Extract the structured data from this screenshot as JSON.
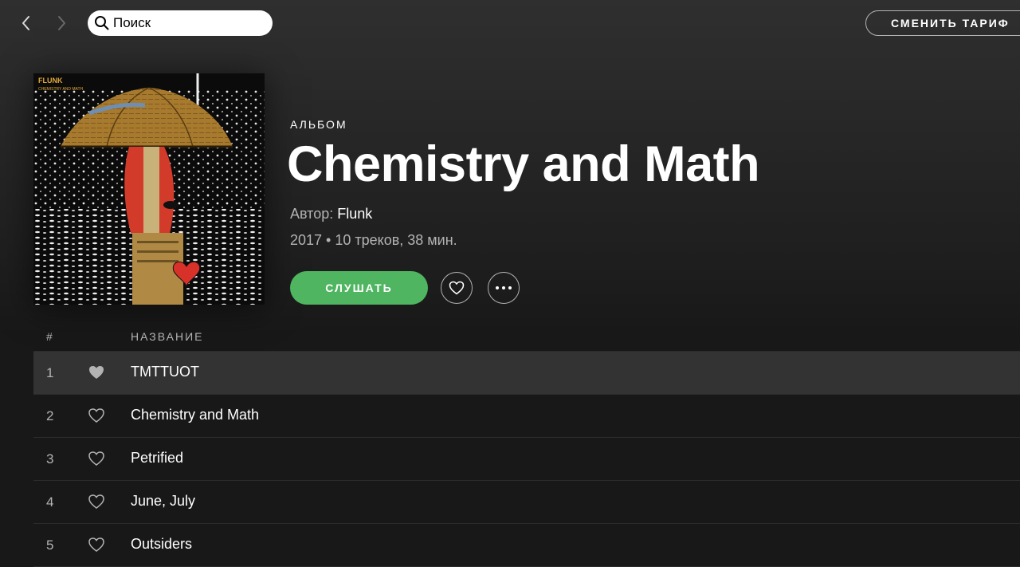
{
  "topbar": {
    "search": {
      "placeholder": "Поиск"
    },
    "upgrade_label": "СМЕНИТЬ ТАРИФ"
  },
  "album": {
    "type_label": "АЛЬБОМ",
    "title": "Chemistry and Math",
    "artist_prefix": "Автор:",
    "artist": "Flunk",
    "meta": "2017 • 10 треков, 38 мин.",
    "cover_text": {
      "band": "FLUNK",
      "subtitle": "CHEMISTRY AND MATH"
    }
  },
  "actions": {
    "play_label": "СЛУШАТЬ"
  },
  "tracklist": {
    "header": {
      "number": "#",
      "title": "НАЗВАНИЕ"
    },
    "tracks": [
      {
        "number": "1",
        "title": "TMTTUOT",
        "liked": true,
        "active": true
      },
      {
        "number": "2",
        "title": "Chemistry and Math",
        "liked": false,
        "active": false
      },
      {
        "number": "3",
        "title": "Petrified",
        "liked": false,
        "active": false
      },
      {
        "number": "4",
        "title": "June, July",
        "liked": false,
        "active": false
      },
      {
        "number": "5",
        "title": "Outsiders",
        "liked": false,
        "active": false
      }
    ]
  },
  "colors": {
    "accent_green": "#4fb560",
    "background": "#181818",
    "active_row": "#333333",
    "secondary_text": "#b3b3b3"
  },
  "icons": {
    "back": "chevron-left-icon",
    "forward": "chevron-right-icon",
    "search": "search-icon",
    "like": "heart-icon",
    "more": "more-dots-icon"
  }
}
